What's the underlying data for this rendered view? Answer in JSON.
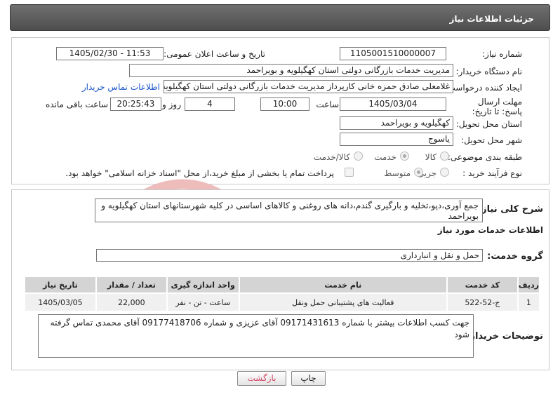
{
  "panel": {
    "title": "جزئیات اطلاعات نیاز"
  },
  "form": {
    "need_number_label": "شماره نیاز:",
    "need_number": "1105001510000007",
    "announce_label": "تاریخ و ساعت اعلان عمومی:",
    "announce_value": "1405/02/30 - 11:53",
    "buyer_org_label": "نام دستگاه خریدار:",
    "buyer_org": "مدیریت خدمات بازرگانی دولتی استان کهگیلویه و بویراحمد",
    "creator_label": "ایجاد کننده درخواست:",
    "creator": "غلامعلی صادق حمزه خانی کارپرداز مدیریت خدمات بازرگانی دولتی استان کهگیلویه و بویراحمد",
    "contact_link": "اطلاعات تماس خریدار",
    "deadline_label": "مهلت ارسال پاسخ: تا تاریخ:",
    "deadline_date": "1405/03/04",
    "time_label": "ساعت",
    "deadline_time": "10:00",
    "days_value": "4",
    "days_label": "روز و",
    "remaining_time": "20:25:43",
    "remaining_label": "ساعت باقی مانده",
    "province_label": "استان محل تحویل:",
    "province": "کهگیلویه و بویراحمد",
    "city_label": "شهر محل تحویل:",
    "city": "یاسوج",
    "category_label": "طبقه بندی موضوعی:",
    "category_options": [
      "کالا",
      "خدمت",
      "کالا/خدمت"
    ],
    "category_selected": "خدمت",
    "process_label": "نوع فرآیند خرید :",
    "process_options": [
      "جزیی",
      "متوسط"
    ],
    "process_selected": "متوسط",
    "payment_note": "پرداخت تمام یا بخشی از مبلغ خرید،از محل \"اسناد خزانه اسلامی\" خواهد بود."
  },
  "details": {
    "summary_label": "شرح کلی نیاز:",
    "summary": "جمع آوری،دپو،تخلیه و بارگیری گندم،دانه های روغنی و کالاهای اساسی در کلیه شهرستانهای استان کهگیلویه و بویراحمد",
    "services_heading": "اطلاعات خدمات مورد نیاز",
    "service_group_label": "گروه خدمت:",
    "service_group": "حمل و نقل و انبارداری",
    "table": {
      "headers": [
        "ردیف",
        "کد خدمت",
        "نام خدمت",
        "واحد اندازه گیری",
        "تعداد / مقدار",
        "تاریخ نیاز"
      ],
      "rows": [
        [
          "1",
          "ج-52-522",
          "فعالیت های پشتیبانی حمل ونقل",
          "ساعت - تن - نفر",
          "22,000",
          "1405/03/05"
        ]
      ]
    },
    "buyer_notes_label": "توضیحات خریدار:",
    "buyer_notes": "جهت کسب اطلاعات بیشتر با شماره 09171431613 آقای عزیزی و شماره 09177418706 آقای محمدی تماس گرفته شود"
  },
  "buttons": {
    "print": "چاپ",
    "back": "بازگشت"
  },
  "watermark": {
    "brand": "AriaTender.neT"
  },
  "colors": {
    "header_bg": "#5e5e5e",
    "link": "#1a56c9",
    "back_button_text": "#d0506a",
    "watermark": "#e9a6a6"
  }
}
